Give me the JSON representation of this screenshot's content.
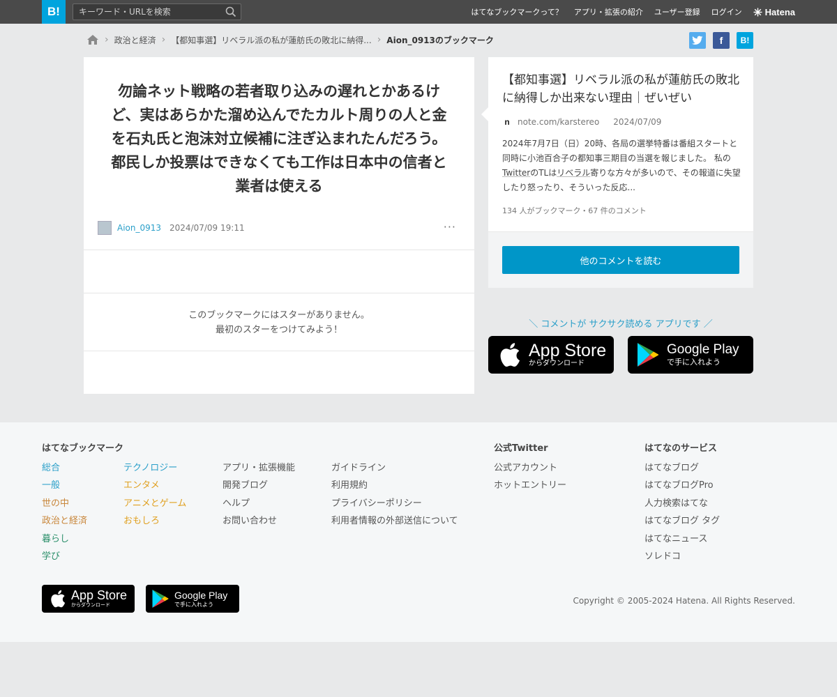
{
  "header": {
    "logo": "B!",
    "search_placeholder": "キーワード・URLを検索",
    "nav": [
      "はてなブックマークって？",
      "アプリ・拡張の紹介",
      "ユーザー登録",
      "ログイン"
    ],
    "brand": "Hatena"
  },
  "breadcrumb": {
    "items": [
      "政治と経済",
      "【都知事選】リベラル派の私が蓮舫氏の敗北に納得..."
    ],
    "current": "Aion_0913のブックマーク"
  },
  "share": {
    "facebook": "f",
    "hatena": "B!"
  },
  "comment": {
    "text": "勿論ネット戦略の若者取り込みの遅れとかあるけど、実はあらかた溜め込んでたカルト周りの人と金を石丸氏と泡沫対立候補に注ぎ込まれたんだろう。都民しか投票はできなくても工作は日本中の信者と業者は使える",
    "user": "Aion_0913",
    "date": "2024/07/09 19:11",
    "more": "···"
  },
  "stars": {
    "line1": "このブックマークにはスターがありません。",
    "line2": "最初のスターをつけてみよう！"
  },
  "entry": {
    "title": "【都知事選】リベラル派の私が蓮舫氏の敗北に納得しか出来ない理由｜ぜいぜい",
    "favicon": "n",
    "domain": "note.com/karstereo",
    "date": "2024/07/09",
    "desc_a": "2024年7月7日（日）20時、各局の選挙特番は番組スタートと同時に小池百合子の都知事三期目の当選を報じました。 私の",
    "desc_twitter": "Twitter",
    "desc_b": "のTLは",
    "desc_liberal": "リベラル",
    "desc_c": "寄りな方々が多いので、その報道に失望したり怒ったり、そういった反応...",
    "count": "134 人がブックマーク・67 件のコメント",
    "read_button": "他のコメントを読む"
  },
  "app_promo": {
    "text": "＼ コメントが サクサク読める アプリです ／",
    "appstore_big": "App Store",
    "appstore_small": "からダウンロード",
    "googleplay_big": "Google Play",
    "googleplay_small": "で手に入れよう"
  },
  "footer": {
    "col1_title": "はてなブックマーク",
    "categories_a": [
      {
        "label": "総合",
        "color": "#2a9fc9"
      },
      {
        "label": "一般",
        "color": "#2a9fc9"
      },
      {
        "label": "世の中",
        "color": "#c8863a"
      },
      {
        "label": "政治と経済",
        "color": "#c8863a"
      },
      {
        "label": "暮らし",
        "color": "#2b8f6a"
      },
      {
        "label": "学び",
        "color": "#2b8f6a"
      }
    ],
    "categories_b": [
      {
        "label": "テクノロジー",
        "color": "#2a9fc9"
      },
      {
        "label": "エンタメ",
        "color": "#e0a020"
      },
      {
        "label": "アニメとゲーム",
        "color": "#e0a020"
      },
      {
        "label": "おもしろ",
        "color": "#e0a020"
      }
    ],
    "links_a": [
      "アプリ・拡張機能",
      "開発ブログ",
      "ヘルプ",
      "お問い合わせ"
    ],
    "links_b": [
      "ガイドライン",
      "利用規約",
      "プライバシーポリシー",
      "利用者情報の外部送信について"
    ],
    "twitter_title": "公式Twitter",
    "twitter_links": [
      "公式アカウント",
      "ホットエントリー"
    ],
    "services_title": "はてなのサービス",
    "services": [
      "はてなブログ",
      "はてなブログPro",
      "人力検索はてな",
      "はてなブログ タグ",
      "はてなニュース",
      "ソレドコ"
    ],
    "copyright": "Copyright © 2005-2024 Hatena. All Rights Reserved."
  },
  "colors": {
    "accent": "#00a4de",
    "button": "#0096c8",
    "link": "#2a9fc9",
    "twitter": "#55acee",
    "facebook": "#3b5998"
  }
}
